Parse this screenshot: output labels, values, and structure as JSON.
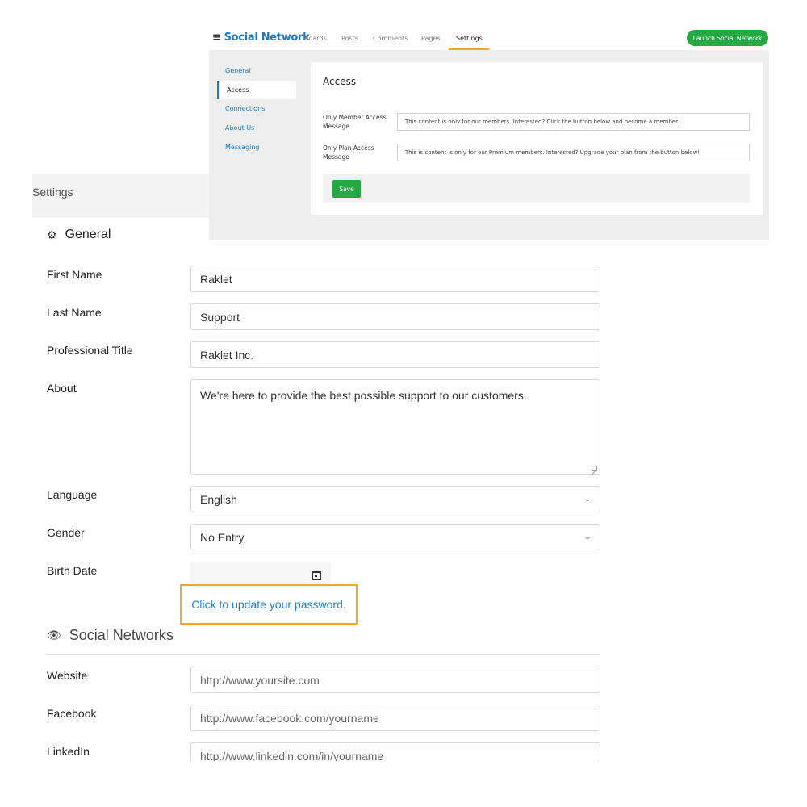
{
  "admin": {
    "brand": "Social Network",
    "nav": [
      "Boards",
      "Posts",
      "Comments",
      "Pages",
      "Settings"
    ],
    "active_nav": "Settings",
    "launch_button": "Launch Social Network",
    "sidebar": [
      "General",
      "Access",
      "Connections",
      "About Us",
      "Messaging"
    ],
    "active_sidebar": "Access",
    "card_title": "Access",
    "fields": [
      {
        "label": "Only Member Access Message",
        "value": "This content is only for our members. Interested? Click the button below and become a member!"
      },
      {
        "label": "Only Plan Access Message",
        "value": "This is content is only for our Premium members. Interested? Upgrade your plan from the button below!"
      }
    ],
    "save_button": "Save"
  },
  "profile": {
    "breadcrumb": "Settings",
    "general_title": "General",
    "fields": {
      "first_name": {
        "label": "First Name",
        "value": "Raklet"
      },
      "last_name": {
        "label": "Last Name",
        "value": "Support"
      },
      "professional_title": {
        "label": "Professional Title",
        "value": "Raklet Inc."
      },
      "about": {
        "label": "About",
        "value": "We're here to provide the best possible support to our customers."
      },
      "language": {
        "label": "Language",
        "value": "English"
      },
      "gender": {
        "label": "Gender",
        "value": "No Entry"
      },
      "birth_date": {
        "label": "Birth Date",
        "value": ""
      }
    },
    "password_link": "Click to update your password.",
    "social_title": "Social Networks",
    "social": {
      "website": {
        "label": "Website",
        "placeholder": "http://www.yoursite.com"
      },
      "facebook": {
        "label": "Facebook",
        "placeholder": "http://www.facebook.com/yourname"
      },
      "linkedin": {
        "label": "LinkedIn",
        "placeholder": "http://www.linkedin.com/in/yourname"
      }
    }
  },
  "colors": {
    "accent_blue": "#1b7bc4",
    "green": "#28a745",
    "highlight_orange": "#f5a623",
    "link_blue": "#1a7fd6"
  }
}
